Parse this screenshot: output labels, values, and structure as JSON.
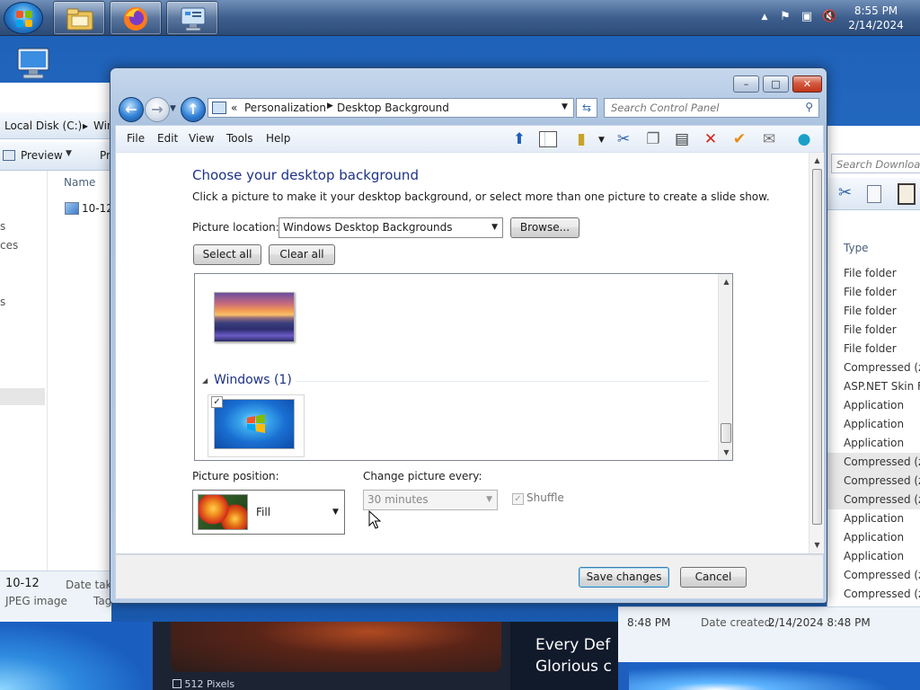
{
  "taskbar": {
    "items": [
      {
        "name": "start-button",
        "icon": "windows-logo-icon"
      },
      {
        "name": "explorer",
        "icon": "folder-icon"
      },
      {
        "name": "firefox",
        "icon": "firefox-icon"
      },
      {
        "name": "control-panel",
        "icon": "control-panel-icon"
      }
    ],
    "tray_icons": [
      "show-hidden-icons-arrow",
      "action-center-flag-icon",
      "network-icon",
      "volume-muted-icon"
    ],
    "clock_time": "8:55 PM",
    "clock_date": "2/14/2024"
  },
  "background_left": {
    "breadcrumb_label": "Local Disk (C:)",
    "breadcrumb_next": "Win",
    "preview_label": "Preview",
    "pr_label": "Pr",
    "column_name": "Name",
    "file_name": "10-12",
    "side_fragments": [
      "s",
      "ces",
      "s"
    ],
    "footer_name": "10-12",
    "footer_type": "JPEG image",
    "footer_date": "Date take",
    "footer_tag": "Tag"
  },
  "background_right": {
    "search_placeholder": "Search Downloads",
    "column_type": "Type",
    "types": [
      "File folder",
      "File folder",
      "File folder",
      "File folder",
      "File folder",
      "Compressed (zip",
      "ASP.NET Skin Fil",
      "Application",
      "Application",
      "Application",
      "Compressed (zip",
      "Compressed (zip",
      "Compressed (zip",
      "Application",
      "Application",
      "Application",
      "Compressed (zip",
      "Compressed (zip"
    ],
    "info_time": "8:48 PM",
    "info_created_label": "Date created:",
    "info_created_value": "2/14/2024 8:48 PM"
  },
  "background_bottom": {
    "pixels_label": "512 Pixels",
    "promo_line1": "Every Def",
    "promo_line2": "Glorious c"
  },
  "window": {
    "caption_buttons": {
      "minimize": "–",
      "maximize": "□",
      "close": "✕"
    },
    "address": {
      "prefix": "«",
      "crumbs": [
        "Personalization",
        "Desktop Background"
      ]
    },
    "search_placeholder": "Search Control Panel",
    "menu": [
      "File",
      "Edit",
      "View",
      "Tools",
      "Help"
    ],
    "toolbar_icons": [
      "up-folder-icon",
      "pane-icon",
      "new-folder-icon",
      "cut-icon",
      "copy-icon",
      "paste-icon",
      "delete-icon",
      "check-icon",
      "mail-icon",
      "globe-icon"
    ]
  },
  "content": {
    "title": "Choose your desktop background",
    "description": "Click a picture to make it your desktop background, or select more than one picture to create a slide show.",
    "picture_location_label": "Picture location:",
    "picture_location_value": "Windows Desktop Backgrounds",
    "browse_label": "Browse...",
    "select_all_label": "Select all",
    "clear_all_label": "Clear all",
    "group_windows_label": "Windows (1)",
    "picture_position_label": "Picture position:",
    "picture_position_value": "Fill",
    "change_every_label": "Change picture every:",
    "change_every_value": "30 minutes",
    "shuffle_label": "Shuffle",
    "shuffle_checked": true,
    "windows_pic_checked": true
  },
  "footer": {
    "save_label": "Save changes",
    "cancel_label": "Cancel"
  },
  "colors": {
    "heading": "#1e3287",
    "desktop": "#1d5fb7"
  }
}
